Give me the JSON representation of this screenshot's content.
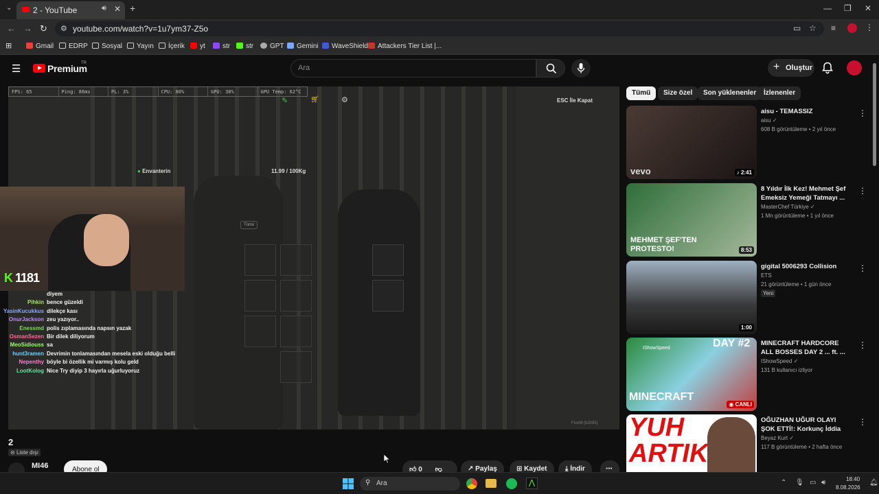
{
  "browser": {
    "tab_title": "2 - YouTube",
    "url": "youtube.com/watch?v=1u7ym37-Z5o",
    "bookmarks": [
      "Gmail",
      "EDRP",
      "Sosyal",
      "Yayın",
      "İçerik",
      "yt",
      "str",
      "str",
      "GPT",
      "Gemini",
      "WaveShield",
      "Attackers Tier List |..."
    ]
  },
  "youtube": {
    "logo_text": "Premium",
    "logo_badge": "TR",
    "search_placeholder": "Ara",
    "create_label": "Oluştur"
  },
  "player": {
    "hud": [
      "FPS: 65",
      "Ping: 86ms",
      "PL: 3%",
      "CPU: 80%",
      "GPU: 38%",
      "GPU Temp: 62°C"
    ],
    "esc_label": "ESC İle Kapat",
    "inventory_label": "Envanterin",
    "weight": "11.99 / 100Kg",
    "filter_chip": "Tümü",
    "cam_badge": "1181",
    "footer_tag": "FiveM (b3095)"
  },
  "chat": [
    {
      "name": "",
      "msg": "diyem",
      "color": "#ffffff"
    },
    {
      "name": "Pihkin",
      "msg": "bence güzeldi",
      "color": "#a6e36a"
    },
    {
      "name": "YasinKucukkus",
      "msg": "dilekçe kası",
      "color": "#8aa8ff"
    },
    {
      "name": "OnurJackson",
      "msg": "zeu yazıyor..",
      "color": "#b68cff"
    },
    {
      "name": "Enessmd",
      "msg": "polis zıplamasında napsın yazak",
      "color": "#7ddc5a"
    },
    {
      "name": "OsmanSezen",
      "msg": "Bir dilek diliyorum",
      "color": "#ff6b9a"
    },
    {
      "name": "MeoSidiouss",
      "msg": "sa",
      "color": "#9dff6a"
    },
    {
      "name": "hunt3ramen",
      "msg": "Devrimin tonlamasından mesela eski olduğu belli",
      "color": "#6ad0ff"
    },
    {
      "name": "Nepenthy",
      "msg": "böyle bi özellik mi varmış kolu geld",
      "color": "#ff7ad0"
    },
    {
      "name": "LootKolog",
      "msg": "Nice Try diyip 3 hayırla uğurluyoruz",
      "color": "#6ae3a0"
    }
  ],
  "video": {
    "title": "2",
    "visibility": "Liste dışı",
    "channel": "MI46",
    "subscribe": "Abone ol",
    "likes": "0",
    "share": "Paylaş",
    "save": "Kaydet",
    "download": "İndir"
  },
  "chips": [
    "Tümü",
    "Size özel",
    "Son yüklenenler",
    "İzlenenler"
  ],
  "recommendations": [
    {
      "title": "aisu - TEMASSIZ",
      "channel": "aisu",
      "meta": "608 B görüntüleme • 2 yıl önce",
      "duration": "2:41",
      "thumb_text": "vevo"
    },
    {
      "title": "8 Yıldır İlk Kez! Mehmet Şef Emeksiz Yemeği Tatmayı ...",
      "channel": "MasterChef Türkiye",
      "meta": "1 Mn görüntüleme • 1 yıl önce",
      "duration": "8:53",
      "thumb_text": "MEHMET ŞEF'TEN PROTESTO!"
    },
    {
      "title": "gigital 5006293 Collision",
      "channel": "ETS",
      "meta": "21 görüntüleme • 1 gün önce",
      "duration": "1:00",
      "badge": "Yeni"
    },
    {
      "title": "MINECRAFT HARDCORE ALL BOSSES DAY 2 ... ft. ...",
      "channel": "IShowSpeed",
      "meta": "131 B kullanıcı izliyor",
      "duration": "CANLI",
      "thumb_text": "DAY #2",
      "thumb_text2": "MINECRAFT",
      "thumb_name": "IShowSpeed"
    },
    {
      "title": "OĞUZHAN UĞUR OLAYI ŞOK ETTİ!: Korkunç İddia",
      "channel": "Beyaz Kurt",
      "meta": "117 B görüntüleme • 2 hafta önce",
      "thumb_text": "YUH ARTIK"
    }
  ],
  "taskbar": {
    "search_placeholder": "Ara",
    "time": "18:40",
    "date": "8.08.2026"
  }
}
